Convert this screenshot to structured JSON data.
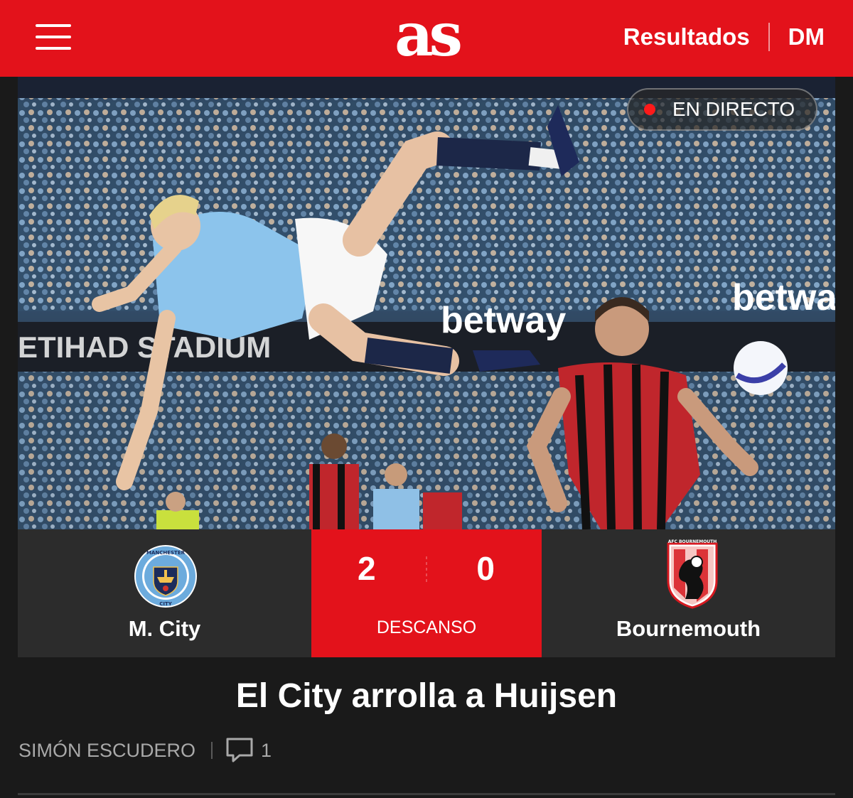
{
  "header": {
    "logo_text": "as",
    "nav": [
      {
        "label": "Resultados"
      },
      {
        "label": "DM"
      }
    ],
    "icons": {
      "menu": "hamburger-menu-icon"
    },
    "colors": {
      "brand": "#e3121b"
    }
  },
  "hero": {
    "live_badge": "EN DIRECTO",
    "colors": {
      "live_dot": "#ff1a1a"
    }
  },
  "match": {
    "home": {
      "name": "M. City",
      "crest": "manchester-city-crest"
    },
    "away": {
      "name": "Bournemouth",
      "crest": "bournemouth-crest"
    },
    "score_home": "2",
    "score_away": "0",
    "status": "DESCANSO"
  },
  "article": {
    "headline": "El City arrolla a Huijsen",
    "author": "SIMÓN ESCUDERO",
    "comment_count": "1",
    "icons": {
      "comments": "comment-bubble-icon"
    }
  }
}
